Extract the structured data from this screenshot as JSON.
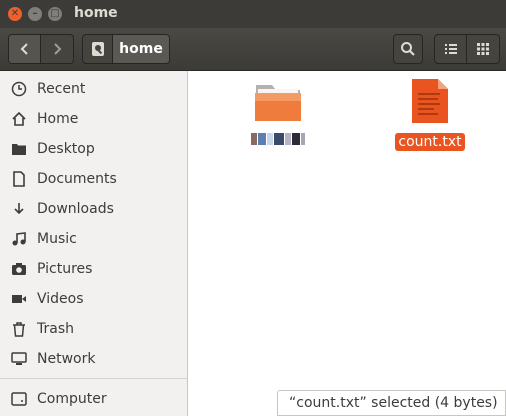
{
  "window": {
    "title": "home"
  },
  "pathbar": {
    "current": "home"
  },
  "sidebar": {
    "items": [
      {
        "label": "Recent",
        "icon": "clock-icon"
      },
      {
        "label": "Home",
        "icon": "home-icon"
      },
      {
        "label": "Desktop",
        "icon": "desktop-folder-icon"
      },
      {
        "label": "Documents",
        "icon": "document-icon"
      },
      {
        "label": "Downloads",
        "icon": "download-icon"
      },
      {
        "label": "Music",
        "icon": "music-icon"
      },
      {
        "label": "Pictures",
        "icon": "camera-icon"
      },
      {
        "label": "Videos",
        "icon": "video-icon"
      },
      {
        "label": "Trash",
        "icon": "trash-icon"
      },
      {
        "label": "Network",
        "icon": "network-icon"
      },
      {
        "label": "Computer",
        "icon": "computer-icon"
      }
    ]
  },
  "files": [
    {
      "name": "",
      "type": "folder",
      "selected": false
    },
    {
      "name": "count.txt",
      "type": "text-file",
      "selected": true
    }
  ],
  "status": {
    "text": "“count.txt” selected  (4 bytes)"
  },
  "colors": {
    "accent": "#e95420",
    "titlebar": "#3c3b37",
    "sidebar_bg": "#f2f1f0"
  }
}
